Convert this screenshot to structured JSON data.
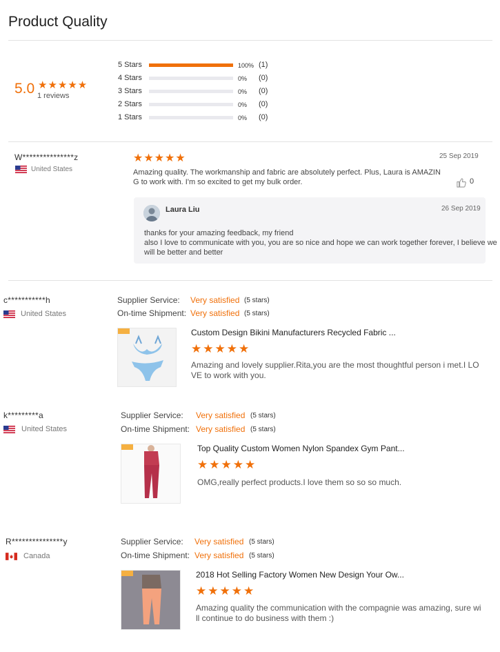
{
  "page": {
    "title": "Product Quality"
  },
  "summary": {
    "score": "5.0",
    "stars": "★★★★★",
    "reviews_count": "1 reviews",
    "distribution": [
      {
        "label": "5 Stars",
        "fraction": 1.0,
        "percent": "100%",
        "count": "(1)"
      },
      {
        "label": "4 Stars",
        "fraction": 0.0,
        "percent": "0%",
        "count": "(0)"
      },
      {
        "label": "3 Stars",
        "fraction": 0.0,
        "percent": "0%",
        "count": "(0)"
      },
      {
        "label": "2 Stars",
        "fraction": 0.0,
        "percent": "0%",
        "count": "(0)"
      },
      {
        "label": "1 Stars",
        "fraction": 0.0,
        "percent": "0%",
        "count": "(0)"
      }
    ]
  },
  "first_review": {
    "name": "W***************z",
    "country": "United States",
    "stars": "★★★★★",
    "date": "25 Sep 2019",
    "text_line1": "Amazing quality. The workmanship and fabric are absolutely perfect. Plus, Laura is AMAZIN",
    "text_line2": "G to work with. I'm so excited to get my bulk order.",
    "likes": "0",
    "reply": {
      "name": "Laura Liu",
      "date": "26 Sep 2019",
      "line1": "thanks for your amazing feedback, my friend",
      "line2": "also I love to communicate with you, you are so nice and hope we can work together forever, I believe we",
      "line3": "will be better and better"
    }
  },
  "service_labels": {
    "supplier": "Supplier Service:",
    "shipment": "On-time Shipment:",
    "value": "Very satisfied",
    "stars": "(5 stars)",
    "product_stars": "★★★★★"
  },
  "reviews": [
    {
      "name": "c***********h",
      "country": "United States",
      "product_title": "Custom Design Bikini Manufacturers Recycled Fabric ...",
      "text_line1": "Amazing and lovely supplier.Rita,you are the most thoughtful person i met.I LO",
      "text_line2": "VE to work with you."
    },
    {
      "name": "k*********a",
      "country": "United States",
      "product_title": "Top Quality Custom Women Nylon Spandex Gym Pant...",
      "text_line1": "OMG,really perfect products.I love them so so so much.",
      "text_line2": ""
    },
    {
      "name": "R***************y",
      "country": "Canada",
      "product_title": "2018 Hot Selling Factory Women New Design Your Ow...",
      "text_line1": "Amazing quality the communication with the compagnie was amazing, sure wi",
      "text_line2": "ll continue to do business with them :)"
    }
  ],
  "colors": {
    "accent": "#f0700a",
    "bar_track": "#e9e9ee",
    "reply_bg": "#f4f4f6"
  },
  "icons": {
    "like": "thumbs-up-icon",
    "flag_us": "us-flag-icon",
    "flag_ca": "canada-flag-icon"
  }
}
